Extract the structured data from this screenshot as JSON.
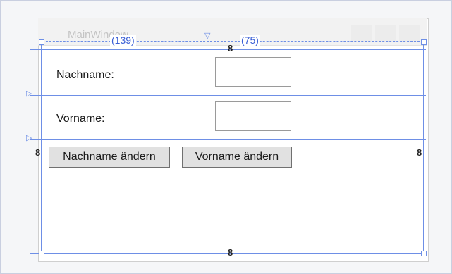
{
  "window": {
    "title": "MainWindow"
  },
  "measures": {
    "col0": "(139)",
    "col1": "(75)"
  },
  "rows": {
    "nachname_label": "Nachname:",
    "vorname_label": "Vorname:"
  },
  "buttons": {
    "change_lastname": "Nachname ändern",
    "change_firstname": "Vorname ändern"
  },
  "icons": {
    "row_marker": "triangle-right-icon",
    "col_marker": "triangle-down-icon",
    "anchor": "chain-link-icon"
  },
  "colors": {
    "grid": "#6e8fe6",
    "button_face": "#e1e1e1"
  }
}
